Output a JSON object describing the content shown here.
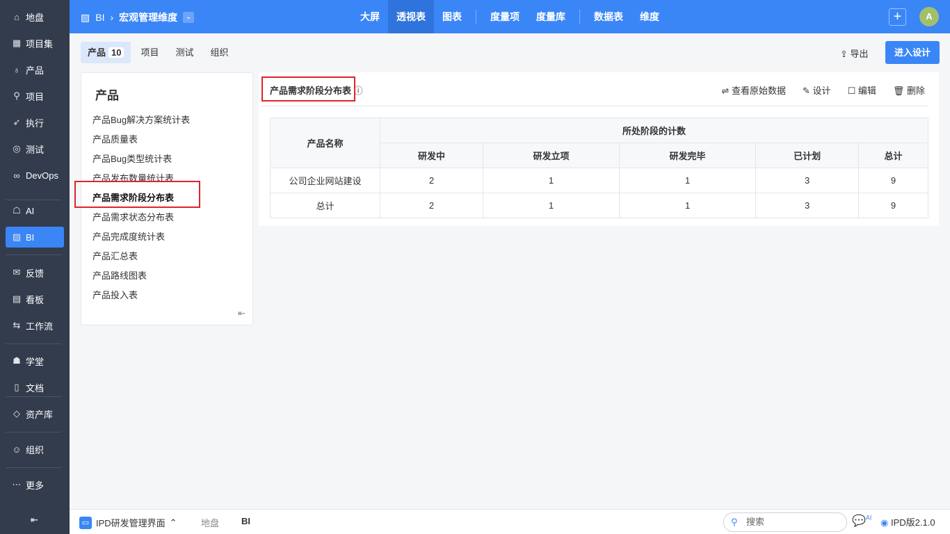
{
  "sidebar": {
    "items": [
      {
        "icon": "home-icon",
        "g": "⌂",
        "label": "地盘"
      },
      {
        "icon": "grid-icon",
        "g": "▦",
        "label": "项目集"
      },
      {
        "icon": "bulb-icon",
        "g": "♁",
        "label": "产品"
      },
      {
        "icon": "rocket-icon",
        "g": "⚲",
        "label": "项目"
      },
      {
        "icon": "run-icon",
        "g": "➶",
        "label": "执行"
      },
      {
        "icon": "search-icon",
        "g": "◎",
        "label": "测试"
      },
      {
        "icon": "infinity-icon",
        "g": "∞",
        "label": "DevOps"
      },
      {
        "icon": "robot-icon",
        "g": "☖",
        "label": "AI"
      },
      {
        "icon": "chart-icon",
        "g": "▨",
        "label": "BI"
      },
      {
        "icon": "feedback-icon",
        "g": "✉",
        "label": "反馈"
      },
      {
        "icon": "board-icon",
        "g": "▤",
        "label": "看板"
      },
      {
        "icon": "workflow-icon",
        "g": "⇆",
        "label": "工作流"
      },
      {
        "icon": "school-icon",
        "g": "☗",
        "label": "学堂"
      },
      {
        "icon": "doc-icon",
        "g": "▯",
        "label": "文档"
      },
      {
        "icon": "diamond-icon",
        "g": "◇",
        "label": "资产库"
      },
      {
        "icon": "users-icon",
        "g": "☺",
        "label": "组织"
      },
      {
        "icon": "more-icon",
        "g": "⋯",
        "label": "更多"
      }
    ],
    "collapse": "⇤"
  },
  "header": {
    "module": "BI",
    "title": "宏观管理维度",
    "nav": [
      "大屏",
      "透视表",
      "图表",
      "度量项",
      "度量库",
      "数据表",
      "维度"
    ],
    "avatar": "A",
    "plus": "+"
  },
  "tabs": [
    {
      "label": "产品",
      "count": "10"
    },
    {
      "label": "项目"
    },
    {
      "label": "测试"
    },
    {
      "label": "组织"
    }
  ],
  "toolbar": {
    "export": "导出",
    "design": "进入设计"
  },
  "left": {
    "title": "产品",
    "items": [
      "产品Bug解决方案统计表",
      "产品质量表",
      "产品Bug类型统计表",
      "产品发布数量统计表",
      "产品需求阶段分布表",
      "产品需求状态分布表",
      "产品完成度统计表",
      "产品汇总表",
      "产品路线图表",
      "产品投入表"
    ]
  },
  "report": {
    "title": "产品需求阶段分布表",
    "actions": [
      "查看原始数据",
      "设计",
      "编辑",
      "删除"
    ],
    "col_name": "产品名称",
    "group": "所处阶段的计数",
    "cols": [
      "研发中",
      "研发立项",
      "研发完毕",
      "已计划",
      "总计"
    ],
    "rows": [
      {
        "name": "公司企业网站建设",
        "v": [
          "2",
          "1",
          "1",
          "3",
          "9"
        ]
      },
      {
        "name": "总计",
        "v": [
          "2",
          "1",
          "1",
          "3",
          "9"
        ]
      }
    ]
  },
  "bottom": {
    "app": "IPD研发管理界面",
    "crumbs": [
      "地盘",
      "BI"
    ],
    "search": "搜索",
    "ai": "AI",
    "version": "IPD版2.1.0"
  }
}
